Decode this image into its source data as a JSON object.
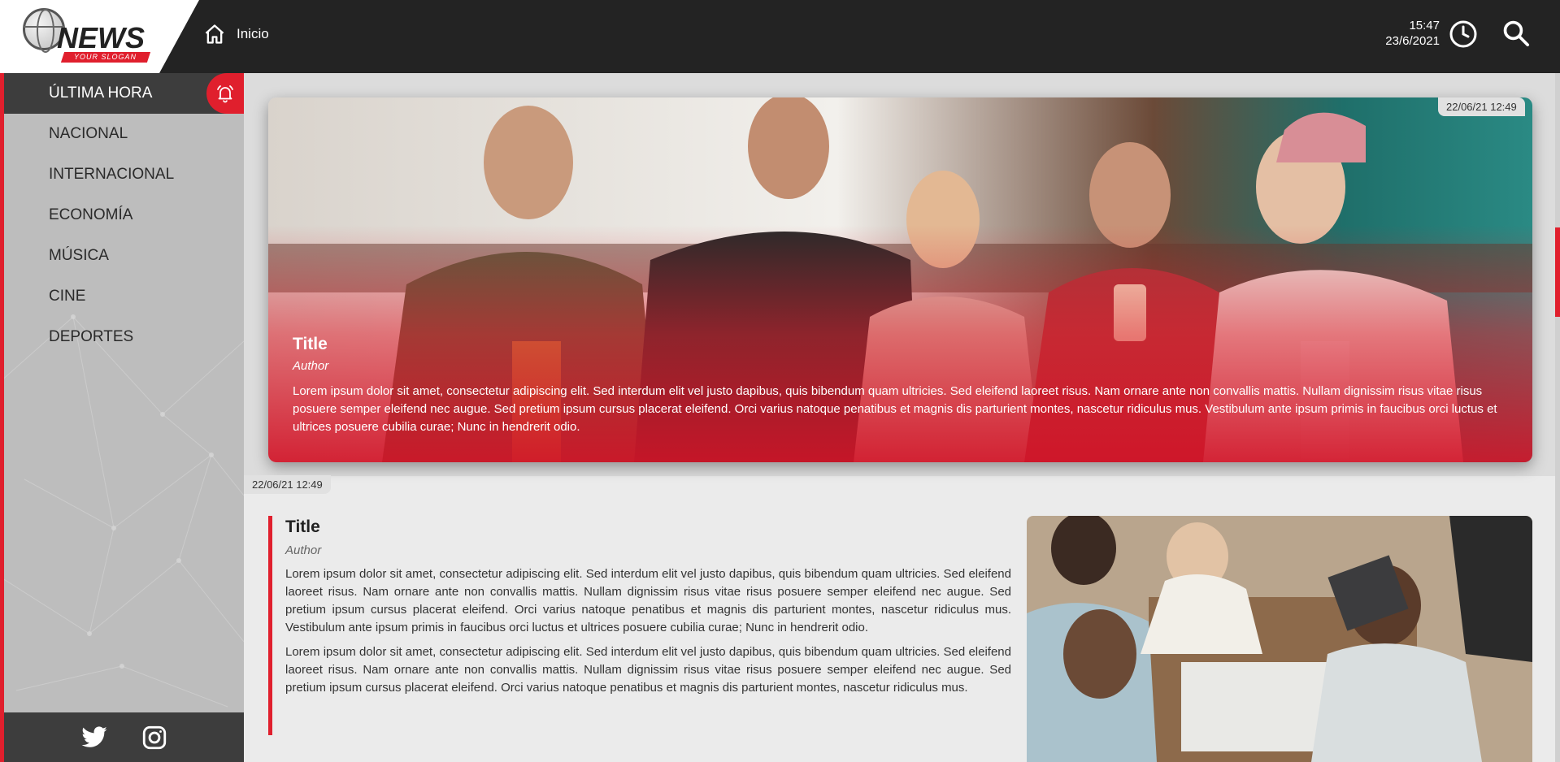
{
  "header": {
    "logo_text": "NEWS",
    "slogan": "YOUR SLOGAN",
    "home_label": "Inicio",
    "time": "15:47",
    "date": "23/6/2021"
  },
  "sidebar": {
    "items": [
      {
        "label": "ÚLTIMA HORA",
        "active": true
      },
      {
        "label": "NACIONAL"
      },
      {
        "label": "INTERNACIONAL"
      },
      {
        "label": "ECONOMÍA"
      },
      {
        "label": "MÚSICA"
      },
      {
        "label": "CINE"
      },
      {
        "label": "DEPORTES"
      }
    ],
    "social": [
      "twitter-icon",
      "instagram-icon"
    ]
  },
  "featured": {
    "date": "22/06/21 12:49",
    "title": "Title",
    "author": "Author",
    "body": "Lorem ipsum dolor sit amet, consectetur adipiscing elit. Sed interdum elit vel justo dapibus, quis bibendum quam ultricies. Sed eleifend laoreet risus. Nam ornare ante non convallis mattis. Nullam dignissim risus vitae risus posuere semper eleifend nec augue. Sed pretium ipsum cursus placerat eleifend. Orci varius natoque penatibus et magnis dis parturient montes, nascetur ridiculus mus. Vestibulum ante ipsum primis in faucibus orci luctus et ultrices posuere cubilia curae; Nunc in hendrerit odio."
  },
  "article": {
    "date": "22/06/21 12:49",
    "title": "Title",
    "author": "Author",
    "paragraphs": [
      "Lorem ipsum dolor sit amet, consectetur adipiscing elit. Sed interdum elit vel justo dapibus, quis bibendum quam ultricies. Sed eleifend laoreet risus. Nam ornare ante non convallis mattis. Nullam dignissim risus vitae risus posuere semper eleifend nec augue. Sed pretium ipsum cursus placerat eleifend. Orci varius natoque penatibus et magnis dis parturient montes, nascetur ridiculus mus. Vestibulum ante ipsum primis in faucibus orci luctus et ultrices posuere cubilia curae; Nunc in hendrerit odio.",
      "Lorem ipsum dolor sit amet, consectetur adipiscing elit. Sed interdum elit vel justo dapibus, quis bibendum quam ultricies. Sed eleifend laoreet risus. Nam ornare ante non convallis mattis. Nullam dignissim risus vitae risus posuere semper eleifend nec augue. Sed pretium ipsum cursus placerat eleifend. Orci varius natoque penatibus et magnis dis parturient montes, nascetur ridiculus mus."
    ]
  },
  "colors": {
    "accent": "#e01f2d",
    "header_bg": "#232323",
    "sidebar_bg": "#bdbdbd",
    "active_bg": "#3d3d3d"
  }
}
